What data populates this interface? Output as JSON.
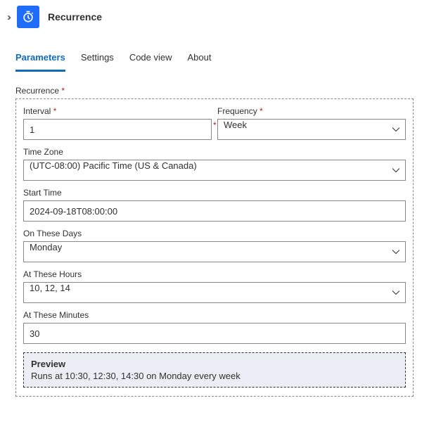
{
  "header": {
    "title": "Recurrence"
  },
  "tabs": [
    "Parameters",
    "Settings",
    "Code view",
    "About"
  ],
  "activeTab": 0,
  "group": {
    "label": "Recurrence",
    "required": true
  },
  "fields": {
    "interval": {
      "label": "Interval",
      "required": true,
      "value": "1"
    },
    "frequency": {
      "label": "Frequency",
      "required": true,
      "value": "Week"
    },
    "timezone": {
      "label": "Time Zone",
      "value": "(UTC-08:00) Pacific Time (US & Canada)"
    },
    "starttime": {
      "label": "Start Time",
      "value": "2024-09-18T08:00:00"
    },
    "days": {
      "label": "On These Days",
      "value": "Monday"
    },
    "hours": {
      "label": "At These Hours",
      "value": "10, 12, 14"
    },
    "minutes": {
      "label": "At These Minutes",
      "value": "30"
    }
  },
  "preview": {
    "title": "Preview",
    "text": "Runs at 10:30, 12:30, 14:30 on Monday every week"
  },
  "requiredMark": "*"
}
